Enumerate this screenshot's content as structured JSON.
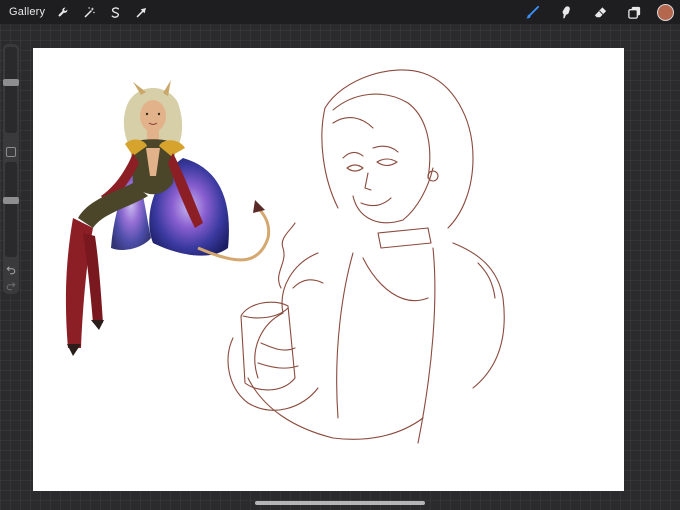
{
  "topbar": {
    "gallery_label": "Gallery",
    "left_tools": [
      "wrench-icon",
      "magic-wand-icon",
      "selection-icon",
      "transform-arrow-icon"
    ],
    "right_tools": [
      "brush-icon",
      "smudge-icon",
      "eraser-icon",
      "layers-icon"
    ],
    "current_color": "#b5674e",
    "active_tool": "brush",
    "active_tool_color": "#3a8ef6"
  },
  "sidebar": {
    "brush_size": 0.6,
    "opacity": 0.6,
    "modify_icon": "square-icon",
    "undo_icon": "undo-icon",
    "redo_icon": "redo-icon"
  },
  "canvas": {
    "background": "#ffffff",
    "artwork": [
      "colored-demon-character",
      "coffee-drinker-line-sketch"
    ],
    "sketch_line_color": "#8a4a3c"
  }
}
